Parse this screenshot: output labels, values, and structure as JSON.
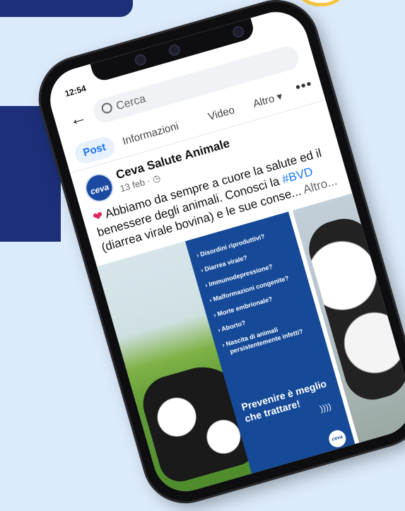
{
  "status": {
    "time": "12:54"
  },
  "search": {
    "placeholder": "Cerca"
  },
  "tabs": {
    "post": "Post",
    "info": "Informazioni",
    "video": "Video",
    "altro": "Altro ▾"
  },
  "more_menu": "•••",
  "post": {
    "author": "Ceva Salute Animale",
    "avatar_text": "ceva",
    "date": "13 feb · ◷",
    "text_heart": "❤",
    "text_main": " Abbiamo da sempre a cuore la salute ed il benessere degli animali. Conosci la ",
    "text_tag": "#BVD",
    "text_end": " (diarrea virale bovina) e le sue conse... ",
    "text_more": "Altro..."
  },
  "ad": {
    "bullets": [
      "› Disordini riproduttivi?",
      "› Diarrea virale?",
      "› Immunodepressione?",
      "› Malformazioni congenite?",
      "› Morte embrionale?",
      "› Aborto?",
      "› Nascita di animali",
      "persistentemente infetti?"
    ],
    "slogan": "Prevenire è meglio che trattare!",
    "chevrons": "))))",
    "logo": "ceva"
  },
  "colors": {
    "brand_navy": "#1c2f78",
    "accent_yellow": "#f6c543",
    "fb_blue": "#1877f2",
    "ad_blue": "#164a98"
  }
}
